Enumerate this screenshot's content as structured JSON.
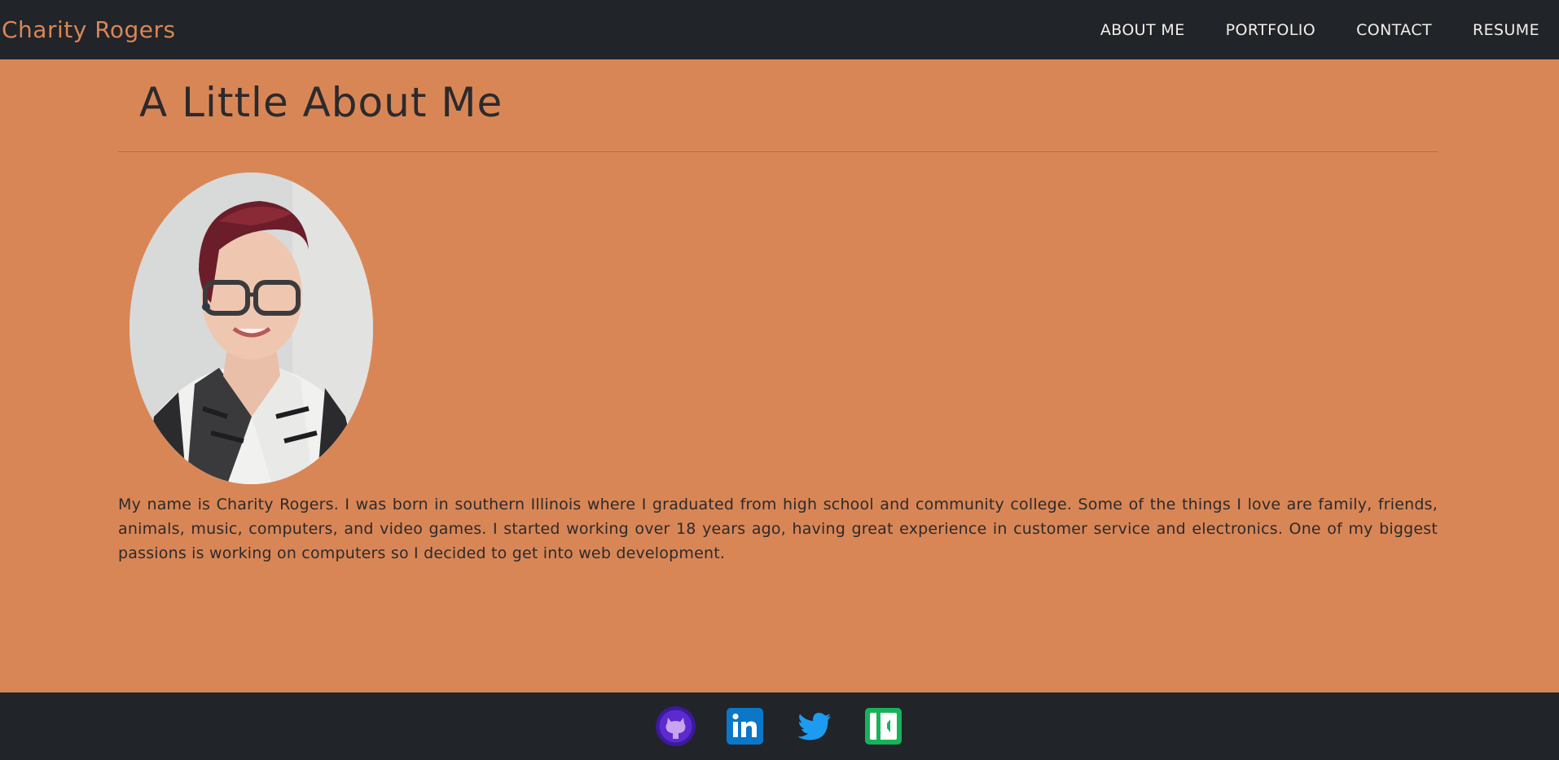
{
  "header": {
    "brand": "Charity Rogers",
    "nav": [
      {
        "label": "ABOUT ME"
      },
      {
        "label": "PORTFOLIO"
      },
      {
        "label": "CONTACT"
      },
      {
        "label": "RESUME"
      }
    ]
  },
  "main": {
    "title": "A Little About Me",
    "bio": "My name is Charity Rogers. I was born in southern Illinois where I graduated from high school and community college. Some of the things I love are family, friends, animals, music, computers, and video games. I started working over 18 years ago, having great experience in customer service and electronics. One of my biggest passions is working on computers so I decided to get into web development."
  },
  "footer": {
    "social_icons": [
      "github-icon",
      "linkedin-icon",
      "twitter-icon",
      "iconfinder-icon"
    ]
  },
  "colors": {
    "accent": "#d98656",
    "dark": "#212429",
    "text": "#2c2a2c",
    "nav_text": "#f3efe9"
  }
}
